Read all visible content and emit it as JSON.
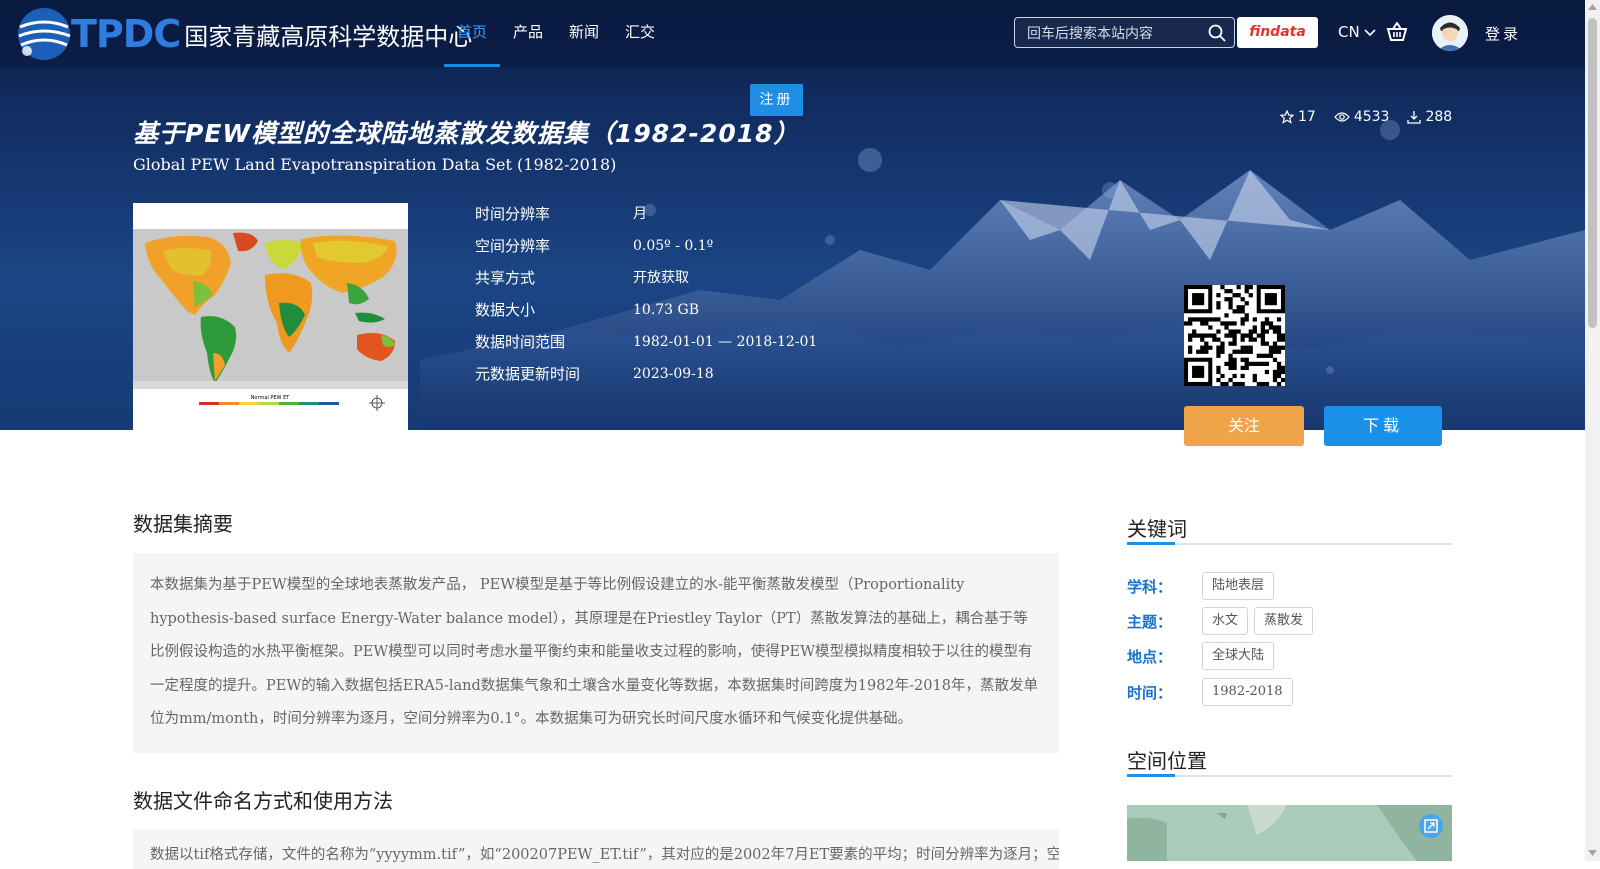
{
  "logo": {
    "letters": "TPDC",
    "name": "国家青藏高原科学数据中心"
  },
  "nav": [
    {
      "label": "首页",
      "active": true
    },
    {
      "label": "产品",
      "active": false
    },
    {
      "label": "新闻",
      "active": false
    },
    {
      "label": "汇交",
      "active": false
    }
  ],
  "search": {
    "placeholder": "回车后搜索本站内容"
  },
  "findata": "findata",
  "lang": "CN",
  "login": "登录",
  "register": "注册",
  "dataset": {
    "title_cn": "基于PEW模型的全球陆地蒸散发数据集（1982-2018）",
    "title_en": "Global PEW Land Evapotranspiration Data Set (1982-2018)",
    "stars": "17",
    "views": "4533",
    "downloads": "288",
    "thumbnail_caption": "Normal PEW ET",
    "meta": [
      {
        "k": "时间分辨率",
        "v": "月"
      },
      {
        "k": "空间分辨率",
        "v": "0.05º - 0.1º"
      },
      {
        "k": "共享方式",
        "v": "开放获取"
      },
      {
        "k": "数据大小",
        "v": "10.73 GB"
      },
      {
        "k": "数据时间范围",
        "v": "1982-01-01 — 2018-12-01"
      },
      {
        "k": "元数据更新时间",
        "v": "2023-09-18"
      }
    ],
    "follow": "关注",
    "download": "下载"
  },
  "abstract": {
    "title": "数据集摘要",
    "text": "本数据集为基于PEW模型的全球地表蒸散发产品， PEW模型是基于等比例假设建立的水-能平衡蒸散发模型（Proportionality hypothesis-based surface Energy-Water balance model），其原理是在Priestley Taylor（PT）蒸散发算法的基础上，耦合基于等比例假设构造的水热平衡框架。PEW模型可以同时考虑水量平衡约束和能量收支过程的影响，使得PEW模型模拟精度相较于以往的模型有一定程度的提升。PEW的输入数据包括ERA5-land数据集气象和土壤含水量变化等数据，本数据集时间跨度为1982年-2018年，蒸散发单位为mm/month，时间分辨率为逐月，空间分辨率为0.1°。本数据集可为研究长时间尺度水循环和气候变化提供基础。"
  },
  "naming": {
    "title": "数据文件命名方式和使用方法",
    "text": "数据以tif格式存储，文件的名称为“yyyymm.tif”，如“200207PEW_ET.tif”，其对应的是2002年7月ET要素的平均；时间分辨率为逐月；空"
  },
  "keywords": {
    "title": "关键词",
    "rows": [
      {
        "label": "学科：",
        "tags": [
          "陆地表层"
        ]
      },
      {
        "label": "主题：",
        "tags": [
          "水文",
          "蒸散发"
        ]
      },
      {
        "label": "地点：",
        "tags": [
          "全球大陆"
        ]
      },
      {
        "label": "时间：",
        "tags": [
          "1982-2018"
        ]
      }
    ]
  },
  "spatial": {
    "title": "空间位置"
  },
  "colors": {
    "accent": "#1a90e8",
    "follow": "#f0a44a",
    "keyword_label": "#1a73c9"
  }
}
